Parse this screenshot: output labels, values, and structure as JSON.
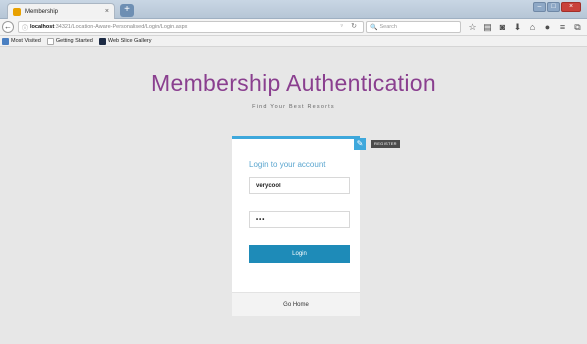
{
  "browser": {
    "tab": {
      "title": "Membership",
      "close": "×"
    },
    "new_tab": "+",
    "window_controls": {
      "minimize": "–",
      "maximize": "□",
      "close": "×"
    },
    "url": {
      "host": "localhost",
      "path": ":34321/Location-Aware-Personalised/Login/Login.aspx"
    },
    "search": {
      "placeholder": "Search"
    },
    "bookmarks": [
      {
        "label": "Most Visited",
        "icon": "star-icon"
      },
      {
        "label": "Getting Started",
        "icon": "page-icon"
      },
      {
        "label": "Web Slice Gallery",
        "icon": "slice-icon"
      }
    ],
    "toolbar_icons": [
      "star-bookmark-icon",
      "reading-list-icon",
      "pocket-icon",
      "download-icon",
      "home-icon",
      "chat-icon",
      "menu-icon",
      "sidebar-icon"
    ],
    "glyphs": {
      "back": "←",
      "lock": "ⓘ",
      "dropdown": "▿",
      "reload": "↻",
      "search": "🔍"
    }
  },
  "page": {
    "title": "Membership Authentication",
    "subtitle": "Find Your Best Resorts"
  },
  "login": {
    "heading": "Login to your account",
    "username_value": "verycool",
    "password_mask": "•••",
    "button_label": "Login",
    "register_tip": "REGISTER",
    "edit_glyph": "✎",
    "footer_link": "Go Home"
  },
  "colors": {
    "title": "#8a3f8f",
    "accent": "#3ea8dc",
    "button": "#1e8bb8",
    "background": "#e7e7e7"
  }
}
